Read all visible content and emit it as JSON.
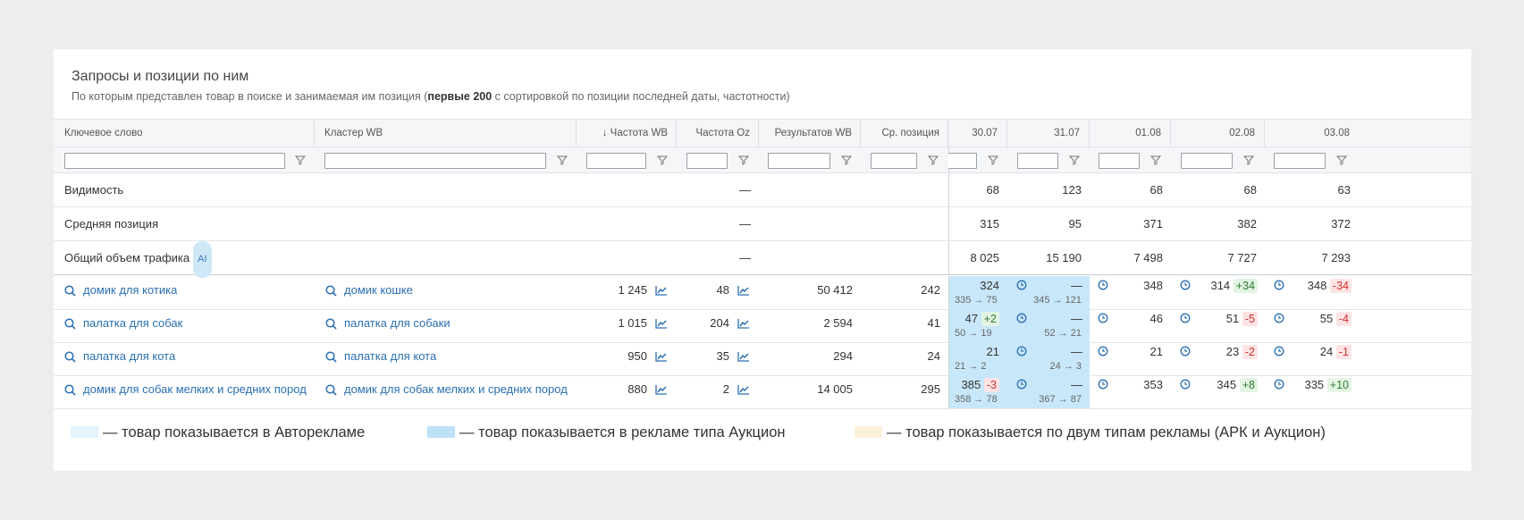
{
  "panel": {
    "title": "Запросы и позиции по ним",
    "subtitle_before": "По которым представлен товар в поиске и занимаемая им позиция (",
    "subtitle_bold": "первые 200",
    "subtitle_after": " с сортировкой по позиции последней даты, частотности)"
  },
  "columns": {
    "keyword": "Ключевое слово",
    "cluster": "Кластер WB",
    "freq_wb": "↓ Частота WB",
    "freq_oz": "Частота Oz",
    "results_wb": "Результатов WB",
    "avg_pos": "Ср. позиция",
    "dates": [
      "30.07",
      "31.07",
      "01.08",
      "02.08",
      "03.08"
    ]
  },
  "aggregates": [
    {
      "label": "Видимость",
      "freq_oz": "—",
      "values": [
        "68",
        "123",
        "68",
        "68",
        "63"
      ]
    },
    {
      "label": "Средняя позиция",
      "freq_oz": "—",
      "values": [
        "315",
        "95",
        "371",
        "382",
        "372"
      ]
    },
    {
      "label": "Общий объем трафика",
      "ai_badge": "AI",
      "freq_oz": "—",
      "values": [
        "8 025",
        "15 190",
        "7 498",
        "7 727",
        "7 293"
      ]
    }
  ],
  "rows": [
    {
      "keyword": "домик для котика",
      "cluster": "домик кошке",
      "freq_wb": "1 245",
      "freq_oz": "48",
      "results_wb": "50 412",
      "avg_pos": "242",
      "d1": {
        "value": "324",
        "change": "",
        "sub": "335 → 75"
      },
      "d2": {
        "value": "—",
        "sub": "345 → 121"
      },
      "d3": {
        "value": "348",
        "change": ""
      },
      "d4": {
        "value": "314",
        "change": "+34"
      },
      "d5": {
        "value": "348",
        "change": "-34"
      }
    },
    {
      "keyword": "палатка для собак",
      "cluster": "палатка для собаки",
      "freq_wb": "1 015",
      "freq_oz": "204",
      "results_wb": "2 594",
      "avg_pos": "41",
      "d1": {
        "value": "47",
        "change": "+2",
        "sub": "50 → 19"
      },
      "d2": {
        "value": "—",
        "sub": "52 → 21"
      },
      "d3": {
        "value": "46",
        "change": ""
      },
      "d4": {
        "value": "51",
        "change": "-5"
      },
      "d5": {
        "value": "55",
        "change": "-4"
      }
    },
    {
      "keyword": "палатка для кота",
      "cluster": "палатка для кота",
      "freq_wb": "950",
      "freq_oz": "35",
      "results_wb": "294",
      "avg_pos": "24",
      "d1": {
        "value": "21",
        "change": "",
        "sub": "21 → 2"
      },
      "d2": {
        "value": "—",
        "sub": "24 → 3"
      },
      "d3": {
        "value": "21",
        "change": ""
      },
      "d4": {
        "value": "23",
        "change": "-2"
      },
      "d5": {
        "value": "24",
        "change": "-1"
      }
    },
    {
      "keyword": "домик для собак мелких и средних пород",
      "cluster": "домик для собак мелких и средних пород",
      "freq_wb": "880",
      "freq_oz": "2",
      "results_wb": "14 005",
      "avg_pos": "295",
      "d1": {
        "value": "385",
        "change": "-3",
        "sub": "358 → 78"
      },
      "d2": {
        "value": "—",
        "sub": "367 → 87"
      },
      "d3": {
        "value": "353",
        "change": ""
      },
      "d4": {
        "value": "345",
        "change": "+8"
      },
      "d5": {
        "value": "335",
        "change": "+10"
      }
    }
  ],
  "legend": [
    {
      "text": "— товар показывается в Авторекламе",
      "color": "#e3f4fd"
    },
    {
      "text": "— товар показывается в рекламе типа Аукцион",
      "color": "#bfe2f8"
    },
    {
      "text": "— товар показывается по двум типам рекламы (АРК и Аукцион)",
      "color": "#fdf1dc"
    }
  ],
  "colors": {
    "link": "#2a6fb3",
    "auction_bg": "#c9e7fa",
    "positive": "#2e7d32",
    "negative": "#d32f2f"
  }
}
